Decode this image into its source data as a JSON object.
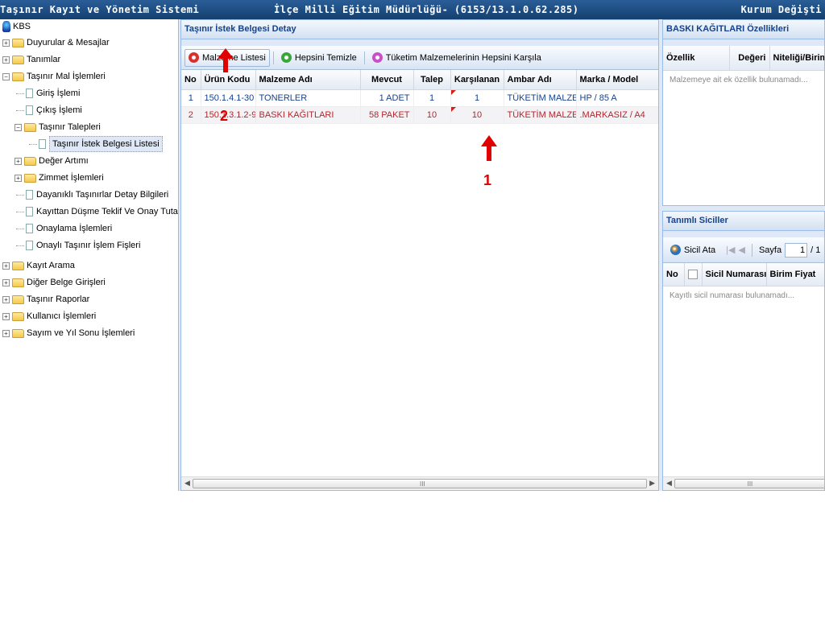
{
  "topbar": {
    "app_title": "Taşınır Kayıt ve Yönetim Sistemi",
    "directorate": "İlçe Milli Eğitim Müdürlüğü- (6153/13.1.0.62.285)",
    "institution_change": "Kurum Değişti"
  },
  "tree": {
    "root": "KBS",
    "items": [
      {
        "label": "Duyurular & Mesajlar"
      },
      {
        "label": "Tanımlar"
      },
      {
        "label": "Taşınır Mal İşlemleri"
      },
      {
        "label": "Giriş İşlemi"
      },
      {
        "label": "Çıkış İşlemi"
      },
      {
        "label": "Taşınır Talepleri"
      },
      {
        "label": "Taşınır İstek Belgesi Listesi"
      },
      {
        "label": "Değer Artımı"
      },
      {
        "label": "Zimmet İşlemleri"
      },
      {
        "label": "Dayanıklı Taşınırlar Detay Bilgileri"
      },
      {
        "label": "Kayıttan Düşme Teklif Ve Onay Tutanağı"
      },
      {
        "label": "Onaylama İşlemleri"
      },
      {
        "label": "Onaylı Taşınır İşlem Fişleri"
      },
      {
        "label": "Kayıt Arama"
      },
      {
        "label": "Diğer Belge Girişleri"
      },
      {
        "label": "Taşınır Raporlar"
      },
      {
        "label": "Kullanıcı İşlemleri"
      },
      {
        "label": "Sayım ve Yıl Sonu İşlemleri"
      }
    ]
  },
  "detail": {
    "title": "Taşınır İstek Belgesi Detay",
    "toolbar": {
      "material_list": "Malzeme Listesi",
      "clear_all": "Hepsini Temizle",
      "meet_all": "Tüketim Malzemelerinin Hepsini Karşıla"
    },
    "columns": [
      "No",
      "Ürün Kodu",
      "Malzeme Adı",
      "Mevcut",
      "Talep",
      "Karşılanan",
      "Ambar Adı",
      "Marka / Model"
    ],
    "rows": [
      {
        "no": "1",
        "code": "150.1.4.1-30",
        "name": "TONERLER",
        "stock": "1  ADET",
        "request": "1",
        "met": "1",
        "warehouse": "TÜKETİM MALZEME...",
        "brand": "HP / 85 A"
      },
      {
        "no": "2",
        "code": "150.1.3.1.2-9",
        "name": "BASKI KAĞITLARI",
        "stock": "58  PAKET",
        "request": "10",
        "met": "10",
        "warehouse": "TÜKETİM MALZEME...",
        "brand": ".MARKASIZ / A4"
      }
    ],
    "scroll_grip": "III"
  },
  "props": {
    "title": "BASKI KAĞITLARI Özellikleri",
    "columns": [
      "Özellik",
      "Değeri",
      "Niteliği/Birimi"
    ],
    "empty": "Malzemeye ait ek özellik bulunamadı..."
  },
  "sicil": {
    "title": "Tanımlı Siciller",
    "assign": "Sicil Ata",
    "page_label": "Sayfa",
    "page_value": "1",
    "page_total": "/ 1",
    "columns": [
      "No",
      "Sicil Numarası",
      "Birim Fiyat"
    ],
    "empty": "Kayıtlı sicil numarası bulunamadı...",
    "scroll_grip": "III"
  },
  "annotations": {
    "one": "1",
    "two": "2",
    "color": "#e00000"
  }
}
